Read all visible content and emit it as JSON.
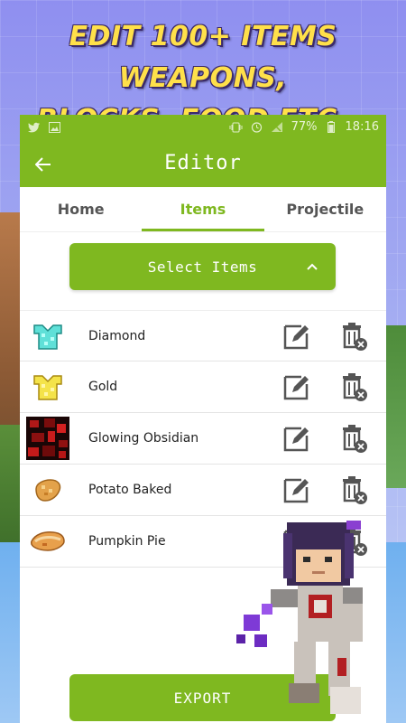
{
  "promo": {
    "headline_line1": "EDIT 100+ ITEMS WEAPONS,",
    "headline_line2": "BLOCKS, FOOD ETC..."
  },
  "status_bar": {
    "battery_percent": "77%",
    "time": "18:16",
    "icons": [
      "twitter-icon",
      "gallery-icon",
      "vibrate-icon",
      "alarm-icon",
      "no-signal-icon",
      "battery-icon"
    ]
  },
  "app_bar": {
    "title": "Editor",
    "back_icon": "arrow-left-icon"
  },
  "tabs": [
    {
      "label": "Home",
      "active": false
    },
    {
      "label": "Items",
      "active": true
    },
    {
      "label": "Projectile",
      "active": false
    }
  ],
  "select": {
    "label": "Select Items",
    "icon": "chevron-up-icon"
  },
  "items": [
    {
      "name": "Diamond",
      "icon": "diamond-chestplate-icon"
    },
    {
      "name": "Gold",
      "icon": "gold-chestplate-icon"
    },
    {
      "name": "Glowing Obsidian",
      "icon": "glowing-obsidian-icon"
    },
    {
      "name": "Potato Baked",
      "icon": "baked-potato-icon"
    },
    {
      "name": "Pumpkin Pie",
      "icon": "pumpkin-pie-icon"
    }
  ],
  "actions": {
    "edit_icon": "edit-icon",
    "delete_icon": "delete-icon"
  },
  "export": {
    "label": "EXPORT"
  },
  "colors": {
    "accent": "#7fb820",
    "headline": "#ffe04a"
  }
}
